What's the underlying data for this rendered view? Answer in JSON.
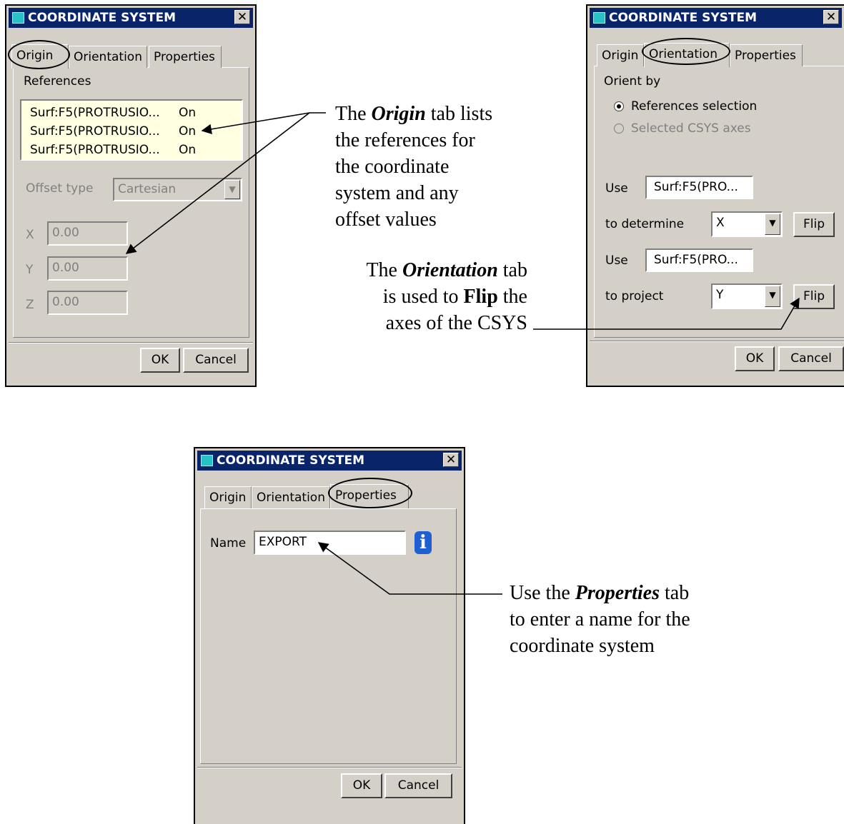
{
  "dialog_title": "COORDINATE SYSTEM",
  "close_label": "✕",
  "tabs": {
    "origin": "Origin",
    "orientation": "Orientation",
    "properties": "Properties"
  },
  "buttons": {
    "ok": "OK",
    "cancel": "Cancel",
    "flip": "Flip"
  },
  "origin_dialog": {
    "references_label": "References",
    "references": [
      {
        "name": "Surf:F5(PROTRUSIO...",
        "state": "On"
      },
      {
        "name": "Surf:F5(PROTRUSIO...",
        "state": "On"
      },
      {
        "name": "Surf:F5(PROTRUSIO...",
        "state": "On"
      }
    ],
    "offset_type_label": "Offset type",
    "offset_type_value": "Cartesian",
    "x_label": "X",
    "x_value": "0.00",
    "y_label": "Y",
    "y_value": "0.00",
    "z_label": "Z",
    "z_value": "0.00"
  },
  "orientation_dialog": {
    "orient_by_label": "Orient by",
    "radio_references": "References selection",
    "radio_references_selected": true,
    "radio_csys": "Selected CSYS axes",
    "use_label_1": "Use",
    "use_value_1": "Surf:F5(PRO...",
    "determine_label": "to determine",
    "determine_value": "X",
    "use_label_2": "Use",
    "use_value_2": "Surf:F5(PRO...",
    "project_label": "to project",
    "project_value": "Y"
  },
  "properties_dialog": {
    "name_label": "Name",
    "name_value": "EXPORT",
    "info_glyph": "i"
  },
  "annotations": {
    "origin_note": {
      "pre": "The ",
      "em": "Origin",
      "post": " tab lists",
      "line2": "the references for",
      "line3": "the coordinate",
      "line4": "system and any",
      "line5": "offset values"
    },
    "orientation_note": {
      "pre": "The ",
      "em": "Orientation",
      "post": " tab",
      "line2_pre": "is used to ",
      "line2_bold": "Flip",
      "line2_post": " the",
      "line3": "axes of the CSYS"
    },
    "properties_note": {
      "pre": "Use the ",
      "em": "Properties",
      "post": " tab",
      "line2": "to enter a name for the",
      "line3": "coordinate system"
    }
  },
  "colors": {
    "dialog_bg": "#d4d0c8",
    "titlebar": "#0a246a",
    "list_bg": "#ffffe1",
    "info_icon": "#1f5fd3"
  }
}
